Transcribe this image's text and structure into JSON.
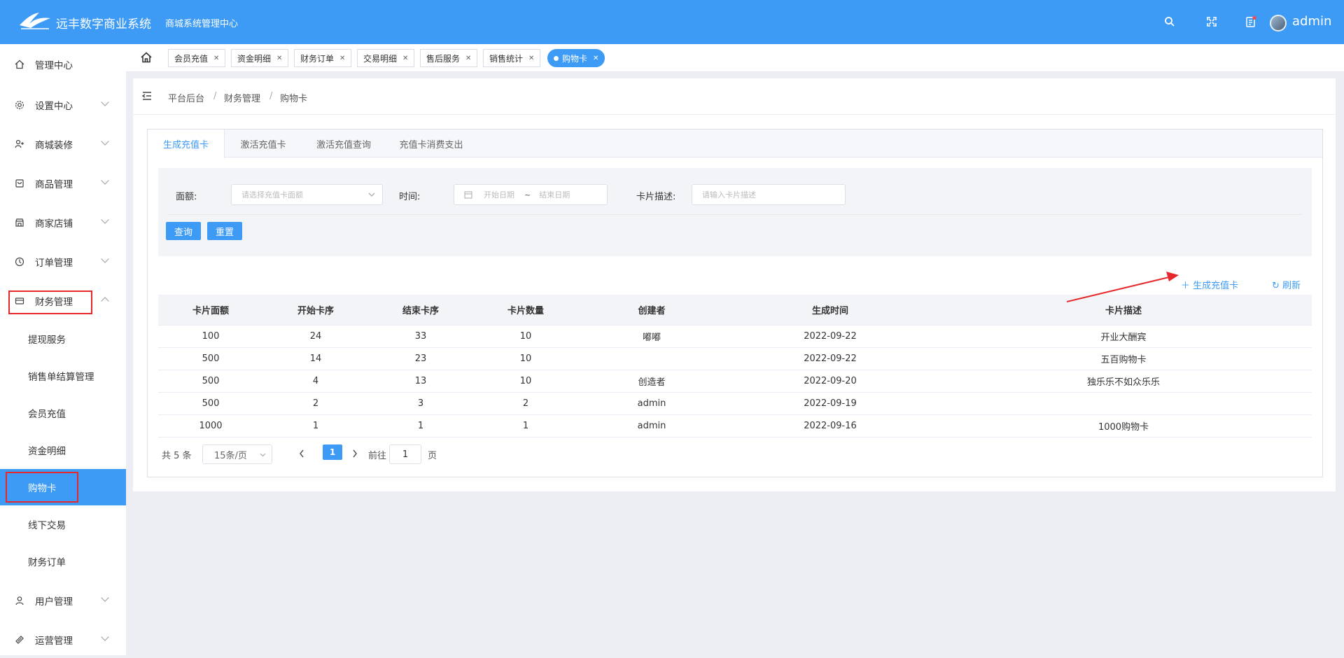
{
  "header": {
    "brand": "远丰数字商业系统",
    "subtitle": "商城系统管理中心",
    "username": "admin",
    "accent": "#3d9bf5"
  },
  "sidebar": {
    "items": [
      {
        "label": "管理中心",
        "icon": "home-icon"
      },
      {
        "label": "设置中心",
        "icon": "gear-icon"
      },
      {
        "label": "商城装修",
        "icon": "decoration-icon"
      },
      {
        "label": "商品管理",
        "icon": "goods-icon"
      },
      {
        "label": "商家店铺",
        "icon": "store-icon"
      },
      {
        "label": "订单管理",
        "icon": "order-icon"
      },
      {
        "label": "财务管理",
        "icon": "finance-icon"
      },
      {
        "label": "用户管理",
        "icon": "user-icon"
      },
      {
        "label": "运营管理",
        "icon": "operation-icon"
      }
    ],
    "finance_sub": [
      "提现服务",
      "销售单结算管理",
      "会员充值",
      "资金明细",
      "购物卡",
      "线下交易",
      "财务订单"
    ]
  },
  "tabs": [
    "会员充值",
    "资金明细",
    "财务订单",
    "交易明细",
    "售后服务",
    "销售统计",
    "购物卡"
  ],
  "breadcrumb": [
    "平台后台",
    "财务管理",
    "购物卡"
  ],
  "breadcrumb_sep": "/",
  "panel_tabs": [
    "生成充值卡",
    "激活充值卡",
    "激活充值查询",
    "充值卡消费支出"
  ],
  "filter": {
    "amount_label": "面额:",
    "amount_placeholder": "请选择充值卡面额",
    "time_label": "时间:",
    "start_placeholder": "开始日期",
    "range_sep": "~",
    "end_placeholder": "结束日期",
    "desc_label": "卡片描述:",
    "desc_placeholder": "请输入卡片描述",
    "query": "查询",
    "reset": "重置"
  },
  "actions": {
    "generate": "＋ 生成充值卡",
    "refresh": "↻ 刷新"
  },
  "table": {
    "columns": [
      "卡片面额",
      "开始卡序",
      "结束卡序",
      "卡片数量",
      "创建者",
      "生成时间",
      "卡片描述"
    ],
    "rows": [
      [
        "100",
        "24",
        "33",
        "10",
        "嘟嘟",
        "2022-09-22",
        "开业大酬宾"
      ],
      [
        "500",
        "14",
        "23",
        "10",
        "",
        "2022-09-22",
        "五百购物卡"
      ],
      [
        "500",
        "4",
        "13",
        "10",
        "创造者",
        "2022-09-20",
        "独乐乐不如众乐乐"
      ],
      [
        "500",
        "2",
        "3",
        "2",
        "admin",
        "2022-09-19",
        ""
      ],
      [
        "1000",
        "1",
        "1",
        "1",
        "admin",
        "2022-09-16",
        "1000购物卡"
      ]
    ]
  },
  "pagination": {
    "total": "共 5 条",
    "page_size": "15条/页",
    "current": "1",
    "goto": "前往",
    "goto_value": "1",
    "page_unit": "页"
  }
}
